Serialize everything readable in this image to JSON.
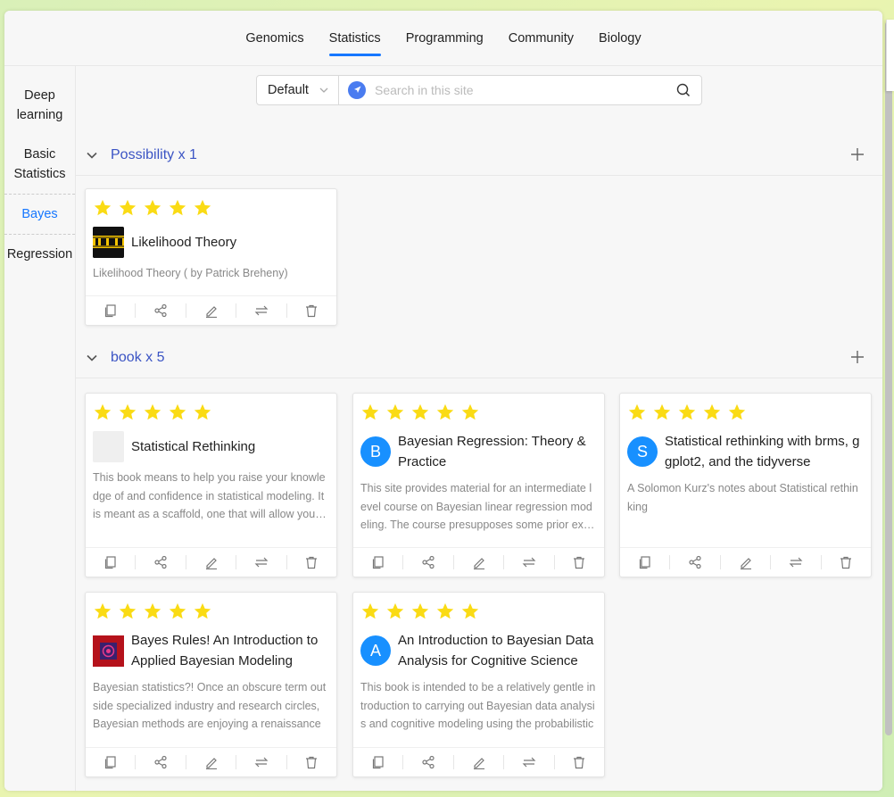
{
  "topnav": {
    "tabs": [
      "Genomics",
      "Statistics",
      "Programming",
      "Community",
      "Biology"
    ],
    "active": 1
  },
  "sidebar": {
    "items": [
      "Deep learning",
      "Basic Statistics",
      "Bayes",
      "Regression"
    ],
    "active": 2
  },
  "search": {
    "select_value": "Default",
    "placeholder": "Search in this site"
  },
  "groups": [
    {
      "title": "Possibility x 1"
    },
    {
      "title": "book x 5"
    }
  ],
  "cards": [
    {
      "title": "Likelihood Theory",
      "desc": "Likelihood Theory ( by Patrick Breheny)",
      "icon": "iowa-logo",
      "rating": 5
    },
    {
      "title": "Statistical Rethinking",
      "desc": "This book means to help you raise your knowledge of and confidence in statistical modeling. It is meant as a scaffold, one that will allow you to construct the understanding",
      "icon": "placeholder-logo",
      "rating": 5
    },
    {
      "title": "Bayesian Regression: Theory & Practice",
      "desc": "This site provides material for an intermediate level course on Bayesian linear regression modeling. The course presupposes some prior exposure",
      "avatar": "B",
      "rating": 5
    },
    {
      "title": "Statistical rethinking with brms, ggplot2, and the tidyverse",
      "desc": "A Solomon Kurz's notes about Statistical rethinking",
      "avatar": "S",
      "rating": 5
    },
    {
      "title": "Bayes Rules! An Introduction to Applied Bayesian Modeling",
      "desc": "Bayesian statistics?! Once an obscure term outside specialized industry and research circles, Bayesian methods are enjoying a renaissance",
      "icon": "bayes-rules-cover",
      "rating": 5
    },
    {
      "title": "An Introduction to Bayesian Data Analysis for Cognitive Science",
      "desc": "This book is intended to be a relatively gentle introduction to carrying out Bayesian data analysis and cognitive modeling using the probabilistic",
      "avatar": "A",
      "rating": 5
    }
  ],
  "colors": {
    "accent": "#1677ff",
    "group_title": "#3b54c4",
    "star": "#fadb14",
    "avatar": "#1890ff"
  }
}
